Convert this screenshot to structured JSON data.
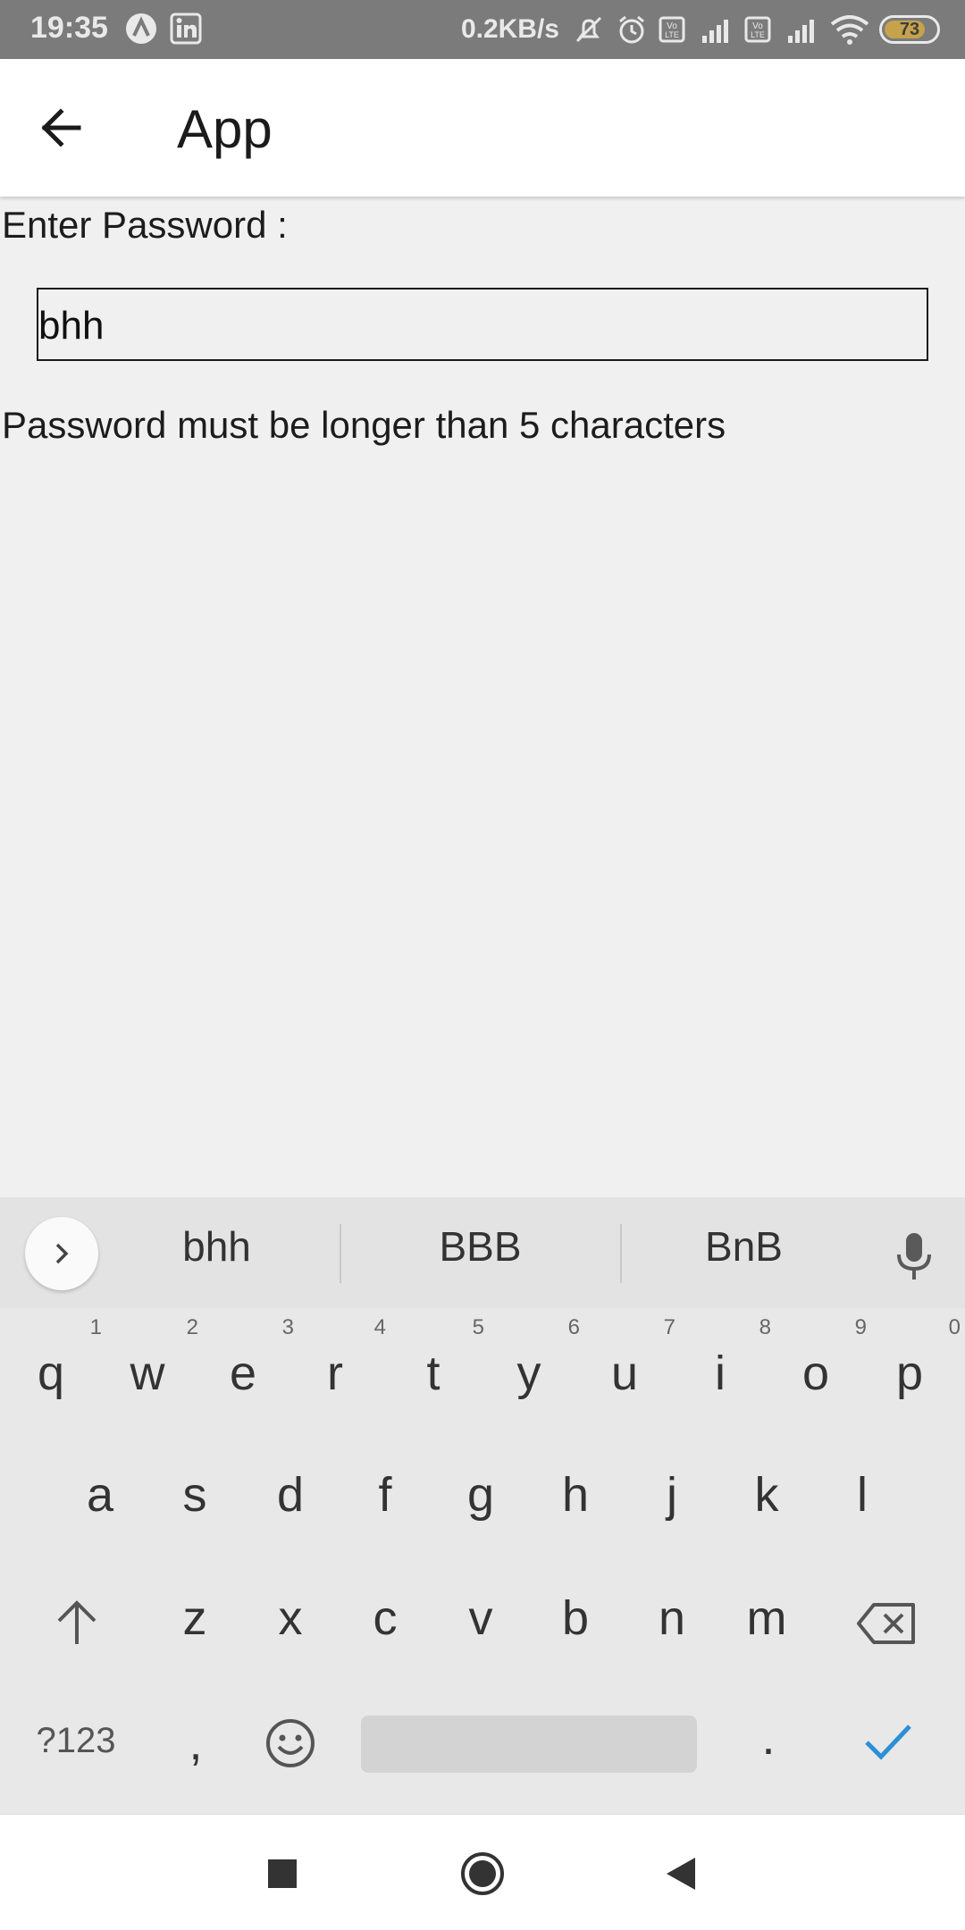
{
  "status_bar": {
    "time": "19:35",
    "network_speed": "0.2KB/s",
    "battery_level": "73",
    "icons": [
      "app-notification-icon",
      "linkedin-icon",
      "mute-icon",
      "alarm-icon",
      "volte-icon",
      "signal-icon",
      "wifi-icon",
      "battery-icon"
    ]
  },
  "app_bar": {
    "title": "App"
  },
  "form": {
    "label": "Enter Password :",
    "password_value": "bhh",
    "error_message": "Password must be longer than 5 characters"
  },
  "keyboard": {
    "suggestions": [
      "bhh",
      "BBB",
      "BnB"
    ],
    "row1": [
      {
        "key": "q",
        "hint": "1"
      },
      {
        "key": "w",
        "hint": "2"
      },
      {
        "key": "e",
        "hint": "3"
      },
      {
        "key": "r",
        "hint": "4"
      },
      {
        "key": "t",
        "hint": "5"
      },
      {
        "key": "y",
        "hint": "6"
      },
      {
        "key": "u",
        "hint": "7"
      },
      {
        "key": "i",
        "hint": "8"
      },
      {
        "key": "o",
        "hint": "9"
      },
      {
        "key": "p",
        "hint": "0"
      }
    ],
    "row2": [
      "a",
      "s",
      "d",
      "f",
      "g",
      "h",
      "j",
      "k",
      "l"
    ],
    "row3": [
      "z",
      "x",
      "c",
      "v",
      "b",
      "n",
      "m"
    ],
    "symbols_label": "?123",
    "comma": ",",
    "period": ".",
    "accent_color": "#2b8fd6"
  }
}
